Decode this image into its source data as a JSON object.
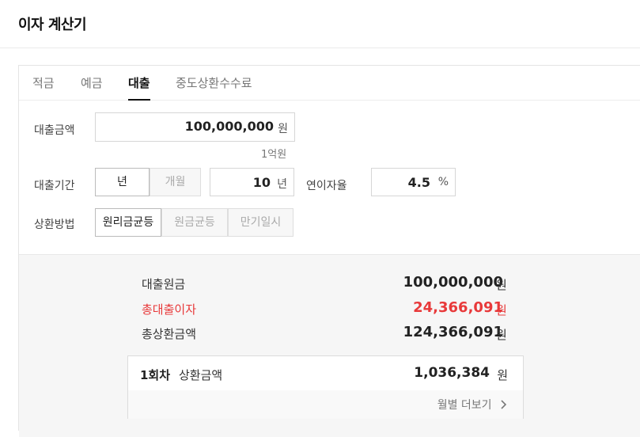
{
  "app": {
    "title": "이자 계산기"
  },
  "tabs": [
    {
      "label": "적금",
      "active": false
    },
    {
      "label": "예금",
      "active": false
    },
    {
      "label": "대출",
      "active": true
    },
    {
      "label": "중도상환수수료",
      "active": false
    }
  ],
  "form": {
    "amount": {
      "label": "대출금액",
      "value": "100,000,000",
      "unit": "원",
      "hint": "1억원"
    },
    "period": {
      "label": "대출기간",
      "unit_options": [
        "년",
        "개월"
      ],
      "selected_unit": "년",
      "value": "10",
      "unit": "년"
    },
    "rate": {
      "label": "연이자율",
      "value": "4.5",
      "unit": "%"
    },
    "method": {
      "label": "상환방법",
      "options": [
        "원리금균등",
        "원금균등",
        "만기일시"
      ],
      "selected": "원리금균등"
    }
  },
  "result": {
    "principal": {
      "label": "대출원금",
      "value": "100,000,000",
      "unit": "원"
    },
    "interest": {
      "label": "총대출이자",
      "value": "24,366,091",
      "unit": "원",
      "color": "#e8393a"
    },
    "total": {
      "label": "총상환금액",
      "value": "124,366,091",
      "unit": "원"
    },
    "installment": {
      "prefix": "1회차",
      "label": "상환금액",
      "value": "1,036,384",
      "unit": "원"
    },
    "monthly_link": {
      "label": "월별 더보기"
    }
  },
  "colors": {
    "accent_red": "#e8393a",
    "text_dark": "#111111",
    "border": "#d6d6d6",
    "result_bg": "#f6f6f6"
  },
  "icons": {
    "more": "chevron-right-icon"
  }
}
